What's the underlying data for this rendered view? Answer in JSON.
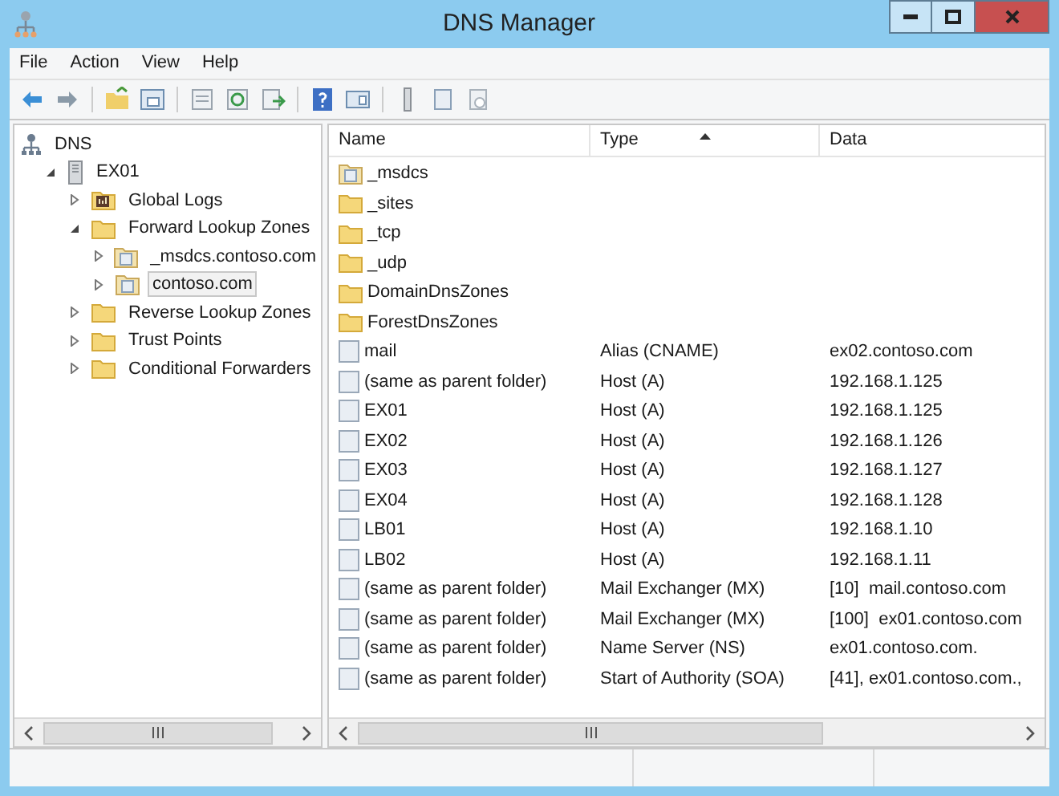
{
  "window": {
    "title": "DNS Manager"
  },
  "menu": [
    "File",
    "Action",
    "View",
    "Help"
  ],
  "tree": [
    {
      "label": "DNS",
      "kind": "dns",
      "selected": false,
      "children": [
        {
          "label": "EX01",
          "kind": "server",
          "expanded": true,
          "selected": false,
          "children": [
            {
              "label": "Global Logs",
              "kind": "logs",
              "expanded": false,
              "selected": false
            },
            {
              "label": "Forward Lookup Zones",
              "kind": "folder",
              "expanded": true,
              "selected": false,
              "children": [
                {
                  "label": "_msdcs.contoso.com",
                  "kind": "zone",
                  "expanded": false,
                  "selected": false
                },
                {
                  "label": "contoso.com",
                  "kind": "zone",
                  "expanded": false,
                  "selected": true
                }
              ]
            },
            {
              "label": "Reverse Lookup Zones",
              "kind": "folder",
              "expanded": false,
              "selected": false
            },
            {
              "label": "Trust Points",
              "kind": "folder",
              "expanded": false,
              "selected": false
            },
            {
              "label": "Conditional Forwarders",
              "kind": "folder",
              "expanded": false,
              "selected": false
            }
          ]
        }
      ]
    }
  ],
  "table": {
    "columns": [
      {
        "label": "Name",
        "sorted": false
      },
      {
        "label": "Type",
        "sorted": true
      },
      {
        "label": "Data",
        "sorted": false
      }
    ],
    "rows": [
      {
        "kind": "zone-folder",
        "name": "_msdcs"
      },
      {
        "kind": "folder",
        "name": "_sites"
      },
      {
        "kind": "folder",
        "name": "_tcp"
      },
      {
        "kind": "folder",
        "name": "_udp"
      },
      {
        "kind": "folder",
        "name": "DomainDnsZones"
      },
      {
        "kind": "folder",
        "name": "ForestDnsZones"
      },
      {
        "kind": "record",
        "name": "mail",
        "type": "Alias (CNAME)",
        "data": "ex02.contoso.com"
      },
      {
        "kind": "record",
        "name": "(same as parent folder)",
        "type": "Host (A)",
        "data": "192.168.1.125"
      },
      {
        "kind": "record",
        "name": "EX01",
        "type": "Host (A)",
        "data": "192.168.1.125"
      },
      {
        "kind": "record",
        "name": "EX02",
        "type": "Host (A)",
        "data": "192.168.1.126"
      },
      {
        "kind": "record",
        "name": "EX03",
        "type": "Host (A)",
        "data": "192.168.1.127"
      },
      {
        "kind": "record",
        "name": "EX04",
        "type": "Host (A)",
        "data": "192.168.1.128"
      },
      {
        "kind": "record",
        "name": "LB01",
        "type": "Host (A)",
        "data": "192.168.1.10"
      },
      {
        "kind": "record",
        "name": "LB02",
        "type": "Host (A)",
        "data": "192.168.1.11"
      },
      {
        "kind": "record",
        "name": "(same as parent folder)",
        "type": "Mail Exchanger (MX)",
        "data": "[10]  mail.contoso.com"
      },
      {
        "kind": "record",
        "name": "(same as parent folder)",
        "type": "Mail Exchanger (MX)",
        "data": "[100]  ex01.contoso.com"
      },
      {
        "kind": "record",
        "name": "(same as parent folder)",
        "type": "Name Server (NS)",
        "data": "ex01.contoso.com."
      },
      {
        "kind": "record",
        "name": "(same as parent folder)",
        "type": "Start of Authority (SOA)",
        "data": "[41], ex01.contoso.com.,"
      }
    ]
  }
}
